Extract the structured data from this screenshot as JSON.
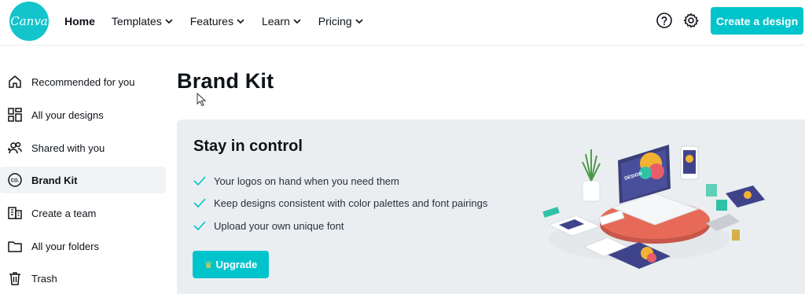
{
  "brand": {
    "logo_text": "Canva",
    "accent": "#00c4cc"
  },
  "nav": {
    "items": [
      {
        "label": "Home",
        "dropdown": false
      },
      {
        "label": "Templates",
        "dropdown": true
      },
      {
        "label": "Features",
        "dropdown": true
      },
      {
        "label": "Learn",
        "dropdown": true
      },
      {
        "label": "Pricing",
        "dropdown": true
      }
    ],
    "help_icon": "question-circle-icon",
    "settings_icon": "gear-icon",
    "cta_label": "Create a design"
  },
  "sidebar": {
    "items": [
      {
        "label": "Recommended for you",
        "icon": "home-icon",
        "active": false
      },
      {
        "label": "All your designs",
        "icon": "grid-icon",
        "active": false
      },
      {
        "label": "Shared with you",
        "icon": "shared-users-icon",
        "active": false
      },
      {
        "label": "Brand Kit",
        "icon": "brand-kit-icon",
        "active": true
      },
      {
        "label": "Create a team",
        "icon": "building-icon",
        "active": false
      },
      {
        "label": "All your folders",
        "icon": "folder-icon",
        "active": false
      },
      {
        "label": "Trash",
        "icon": "trash-icon",
        "active": false
      }
    ]
  },
  "main": {
    "title": "Brand Kit",
    "promo": {
      "title": "Stay in control",
      "features": [
        "Your logos on hand when you need them",
        "Keep designs consistent with color palettes and font pairings",
        "Upload your own unique font"
      ],
      "button_label": "Upgrade",
      "button_icon": "crown-icon"
    }
  }
}
